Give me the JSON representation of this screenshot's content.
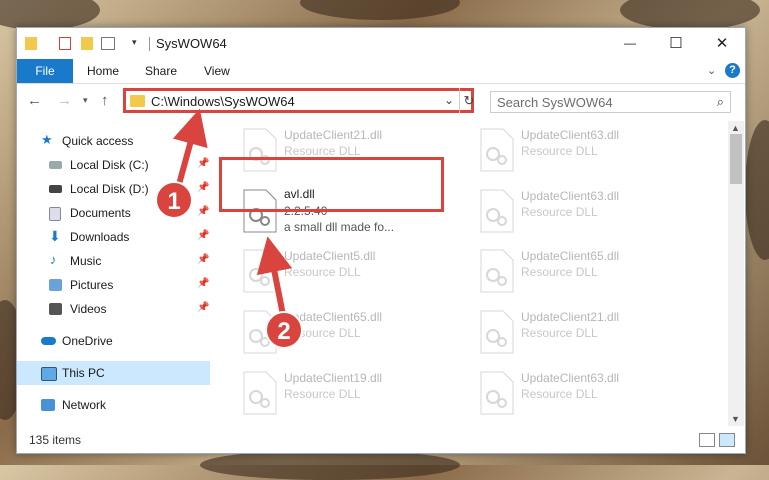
{
  "window": {
    "title": "SysWOW64",
    "controls": {
      "minimize": "—",
      "maximize": "☐",
      "close": "✕"
    }
  },
  "ribbon": {
    "tabs": [
      "File",
      "Home",
      "Share",
      "View"
    ],
    "expand_label": "⌄"
  },
  "address_bar": {
    "path": "C:\\Windows\\SysWOW64",
    "dropdown_icon": "chevron-down-icon",
    "refresh_icon": "refresh-icon"
  },
  "search": {
    "placeholder": "Search SysWOW64"
  },
  "sidebar": {
    "items": [
      {
        "label": "Quick access",
        "icon": "star-icon",
        "pinned": false
      },
      {
        "label": "Local Disk (C:)",
        "icon": "drive-icon",
        "pinned": true
      },
      {
        "label": "Local Disk (D:)",
        "icon": "drive-icon",
        "pinned": true
      },
      {
        "label": "Documents",
        "icon": "documents-icon",
        "pinned": true
      },
      {
        "label": "Downloads",
        "icon": "download-icon",
        "pinned": true
      },
      {
        "label": "Music",
        "icon": "music-icon",
        "pinned": true
      },
      {
        "label": "Pictures",
        "icon": "pictures-icon",
        "pinned": true
      },
      {
        "label": "Videos",
        "icon": "videos-icon",
        "pinned": true
      },
      {
        "label": "OneDrive",
        "icon": "cloud-icon",
        "pinned": false
      },
      {
        "label": "This PC",
        "icon": "computer-icon",
        "pinned": false,
        "selected": true
      },
      {
        "label": "Network",
        "icon": "network-icon",
        "pinned": false
      }
    ]
  },
  "files": {
    "left_column": [
      {
        "name": "UpdateClient21.dll",
        "type": "Resource DLL"
      },
      {
        "name": "avl.dll",
        "version": "2.2.5.40",
        "description": "a small dll made fo..."
      },
      {
        "name": "UpdateClient5.dll",
        "type": "Resource DLL"
      },
      {
        "name": "UpdateClient65.dll",
        "type": "Resource DLL"
      },
      {
        "name": "UpdateClient19.dll",
        "type": "Resource DLL"
      }
    ],
    "right_column": [
      {
        "name": "UpdateClient63.dll",
        "type": "Resource DLL"
      },
      {
        "name": "UpdateClient63.dll",
        "type": "Resource DLL"
      },
      {
        "name": "UpdateClient65.dll",
        "type": "Resource DLL"
      },
      {
        "name": "UpdateClient21.dll",
        "type": "Resource DLL"
      },
      {
        "name": "UpdateClient63.dll",
        "type": "Resource DLL"
      }
    ]
  },
  "status": {
    "item_count": "135 items"
  },
  "callouts": [
    "1",
    "2"
  ],
  "colors": {
    "accent": "#1979ca",
    "highlight": "#d9443e",
    "selected": "#cce8ff"
  }
}
